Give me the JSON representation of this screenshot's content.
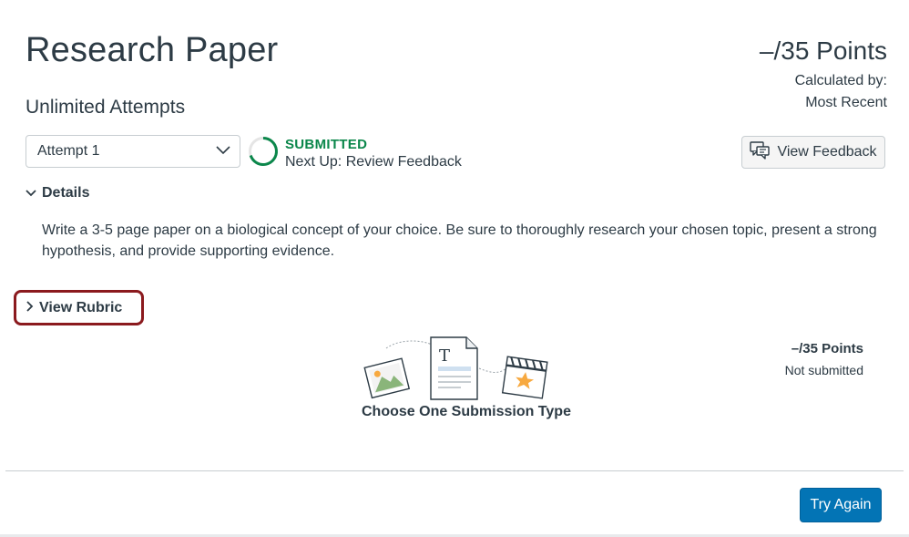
{
  "assignment": {
    "title": "Research Paper",
    "points": "–/35 Points",
    "calculated_by_label": "Calculated by:",
    "calculated_by_value": "Most Recent",
    "attempts_label": "Unlimited Attempts"
  },
  "attempt_select": {
    "selected": "Attempt 1"
  },
  "status": {
    "label": "SUBMITTED",
    "next_up": "Next Up: Review Feedback",
    "color": "#0B874B"
  },
  "feedback_button": {
    "label": "View Feedback",
    "icon": "feedback-comments-icon"
  },
  "details": {
    "toggle_label": "Details",
    "description": "Write a 3-5 page paper on a biological concept of your choice. Be sure to thoroughly research your chosen topic, present a strong hypothesis, and provide supporting evidence."
  },
  "rubric": {
    "toggle_label": "View Rubric",
    "highlight_color": "#8B1A1E"
  },
  "submission": {
    "points": "–/35 Points",
    "status": "Not submitted",
    "choose_label": "Choose One Submission Type"
  },
  "footer": {
    "try_again_label": "Try Again",
    "button_color": "#0374B5"
  }
}
